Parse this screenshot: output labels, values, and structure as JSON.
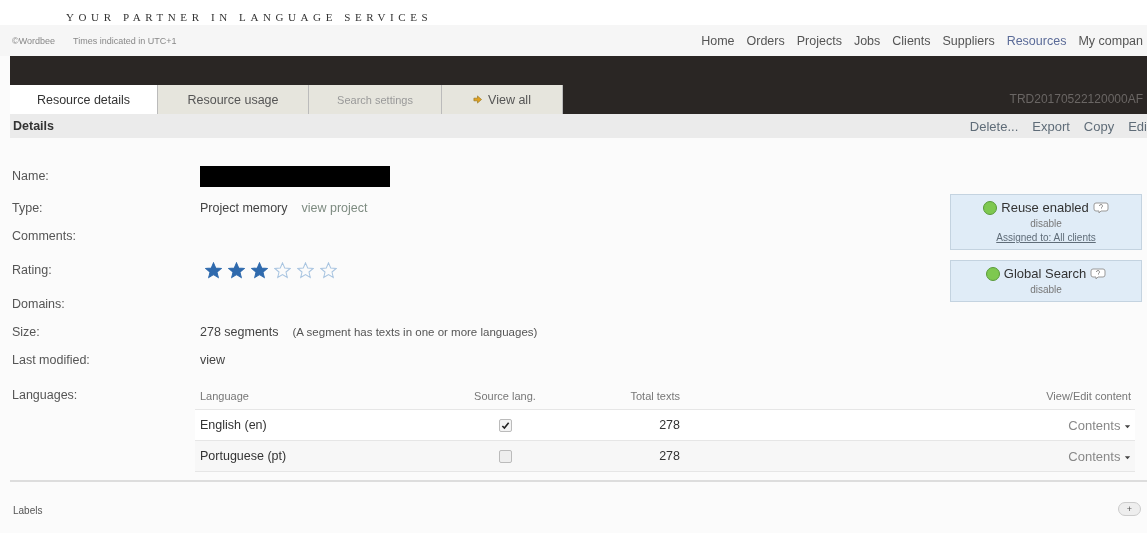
{
  "tagline": "YOUR PARTNER IN LANGUAGE SERVICES",
  "top_bar": {
    "copyright": "©Wordbee",
    "timezone": "Times indicated in UTC+1",
    "nav": [
      {
        "label": "Home",
        "selected": false
      },
      {
        "label": "Orders",
        "selected": false
      },
      {
        "label": "Projects",
        "selected": false
      },
      {
        "label": "Jobs",
        "selected": false
      },
      {
        "label": "Clients",
        "selected": false
      },
      {
        "label": "Suppliers",
        "selected": false
      },
      {
        "label": "Resources",
        "selected": true
      },
      {
        "label": "My compan",
        "selected": false
      }
    ]
  },
  "tabs": [
    {
      "label": "Resource details",
      "selected": true,
      "disabled": false,
      "kind": "plain"
    },
    {
      "label": "Resource usage",
      "selected": false,
      "disabled": false,
      "kind": "plain"
    },
    {
      "label": "Search settings",
      "selected": false,
      "disabled": true,
      "kind": "plain"
    },
    {
      "label": "View all",
      "selected": false,
      "disabled": false,
      "kind": "arrow"
    }
  ],
  "resource_id": "TRD20170522120000AF",
  "details_bar": {
    "title": "Details",
    "actions": [
      "Delete...",
      "Export",
      "Copy",
      "Edi"
    ]
  },
  "fields": [
    {
      "label": "Name:",
      "kind": "redacted"
    },
    {
      "label": "Type:",
      "kind": "type",
      "value": "Project memory",
      "link": "view project"
    },
    {
      "label": "Comments:",
      "kind": "empty"
    },
    {
      "label": "Rating:",
      "kind": "rating",
      "stars": 3
    },
    {
      "label": "Domains:",
      "kind": "empty"
    },
    {
      "label": "Size:",
      "kind": "size",
      "value": "278 segments",
      "note": "(A segment has texts in one or more languages)"
    },
    {
      "label": "Last modified:",
      "kind": "link",
      "link": "view"
    },
    {
      "label": "Languages:",
      "kind": "table"
    }
  ],
  "status_boxes": [
    {
      "title": "Reuse enabled",
      "on": true,
      "action": "disable",
      "assigned": "Assigned to: All clients"
    },
    {
      "title": "Global Search",
      "on": true,
      "action": "disable"
    }
  ],
  "languages_table": {
    "columns": [
      "Language",
      "Source lang.",
      "Total texts",
      "View/Edit content"
    ],
    "rows": [
      {
        "language": "English (en)",
        "source": true,
        "total": "278",
        "contents": "Contents"
      },
      {
        "language": "Portuguese (pt)",
        "source": false,
        "total": "278",
        "contents": "Contents"
      }
    ]
  },
  "labels_bar": {
    "title": "Labels",
    "add": "+"
  }
}
